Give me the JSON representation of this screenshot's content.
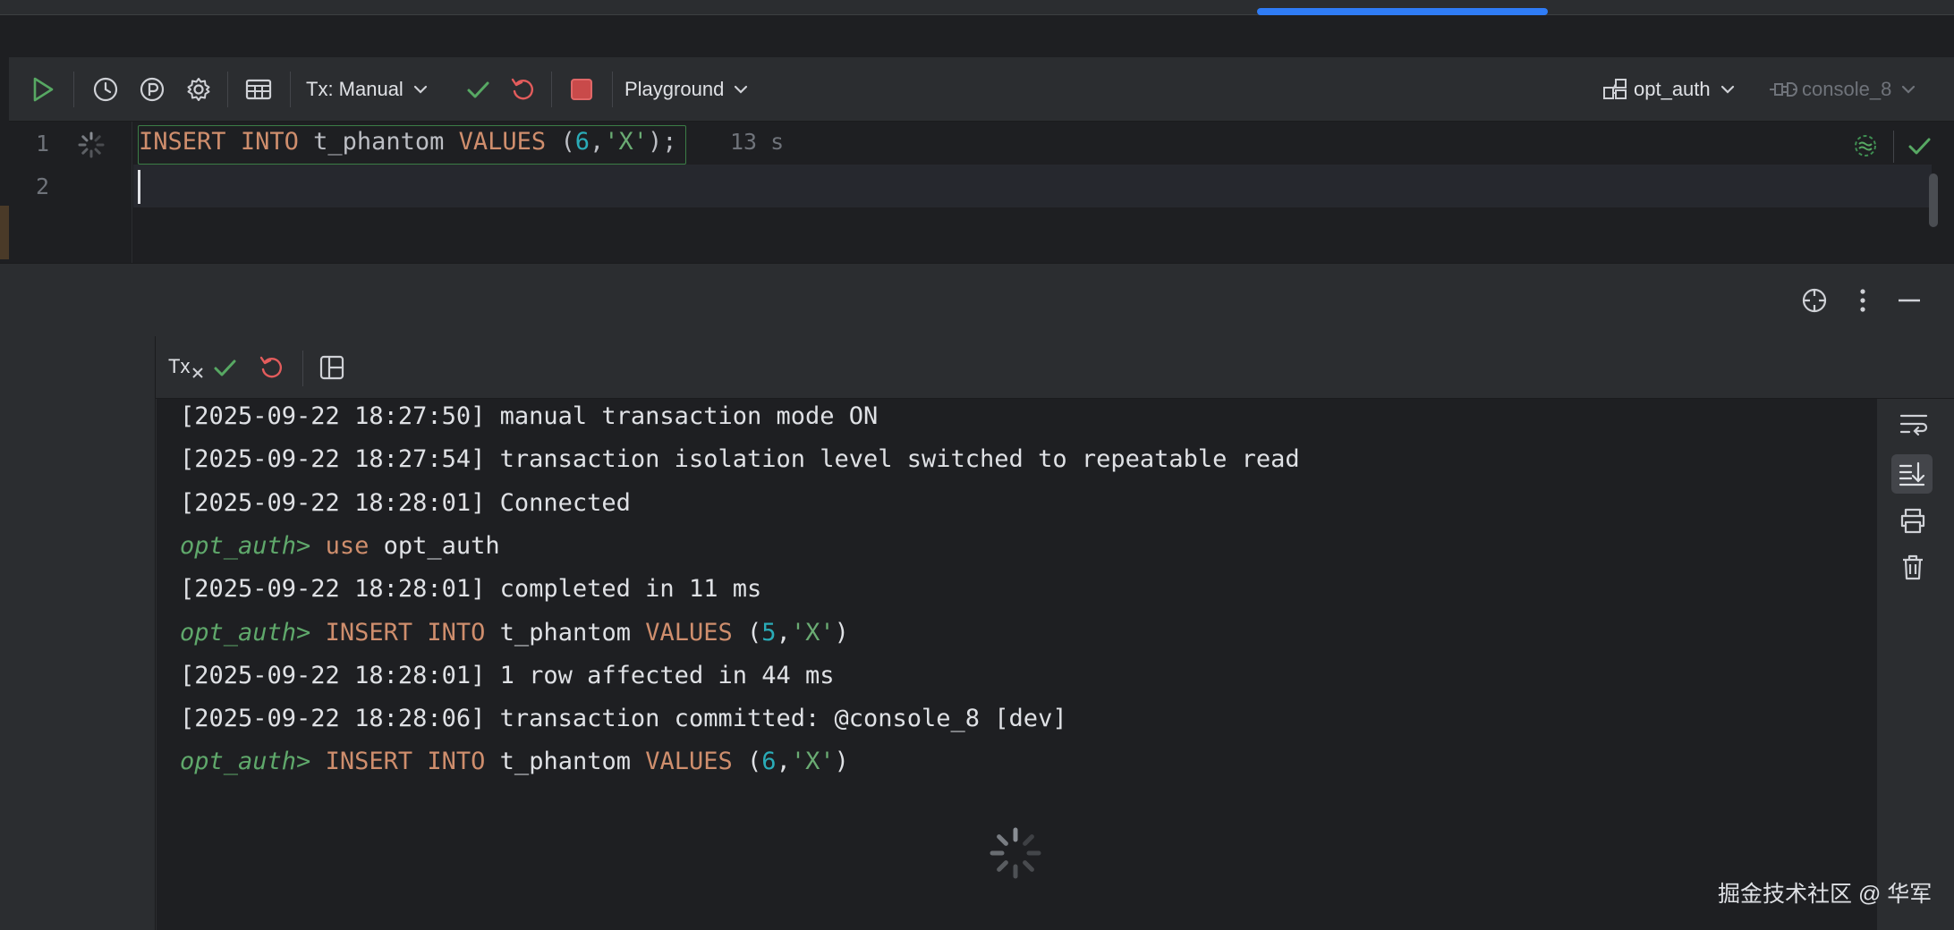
{
  "toolbar": {
    "tx_mode": "Tx: Manual",
    "playground": "Playground",
    "schema": "opt_auth",
    "session": "console_8"
  },
  "editor": {
    "line_numbers": [
      "1",
      "2"
    ],
    "line1_tokens": [
      {
        "t": "INSERT",
        "c": "kw"
      },
      {
        "t": " ",
        "c": ""
      },
      {
        "t": "INTO",
        "c": "kw"
      },
      {
        "t": " t_phantom ",
        "c": ""
      },
      {
        "t": "VALUES",
        "c": "kw"
      },
      {
        "t": " (",
        "c": ""
      },
      {
        "t": "6",
        "c": "num"
      },
      {
        "t": ",",
        "c": ""
      },
      {
        "t": "'X'",
        "c": "str"
      },
      {
        "t": ");",
        "c": ""
      }
    ],
    "elapsed": "13 s"
  },
  "services": {
    "tx_label": "Tx"
  },
  "console": {
    "lines": [
      [
        {
          "t": "[2025-09-22 18:27:50] manual transaction mode ON",
          "c": ""
        }
      ],
      [
        {
          "t": "[2025-09-22 18:27:54] transaction isolation level switched to repeatable read",
          "c": ""
        }
      ],
      [
        {
          "t": "[2025-09-22 18:28:01] Connected",
          "c": ""
        }
      ],
      [
        {
          "t": "opt_auth>",
          "c": "prompt"
        },
        {
          "t": " ",
          "c": ""
        },
        {
          "t": "use",
          "c": "kw"
        },
        {
          "t": " opt_auth",
          "c": ""
        }
      ],
      [
        {
          "t": "[2025-09-22 18:28:01] completed in 11 ms",
          "c": ""
        }
      ],
      [
        {
          "t": "opt_auth>",
          "c": "prompt"
        },
        {
          "t": " ",
          "c": ""
        },
        {
          "t": "INSERT",
          "c": "kw"
        },
        {
          "t": " ",
          "c": ""
        },
        {
          "t": "INTO",
          "c": "kw"
        },
        {
          "t": " t_phantom ",
          "c": ""
        },
        {
          "t": "VALUES",
          "c": "kw"
        },
        {
          "t": " (",
          "c": ""
        },
        {
          "t": "5",
          "c": "num"
        },
        {
          "t": ",",
          "c": ""
        },
        {
          "t": "'X'",
          "c": "str"
        },
        {
          "t": ")",
          "c": ""
        }
      ],
      [
        {
          "t": "[2025-09-22 18:28:01] 1 row affected in 44 ms",
          "c": ""
        }
      ],
      [
        {
          "t": "[2025-09-22 18:28:06] transaction committed: @console_8 [dev]",
          "c": ""
        }
      ],
      [
        {
          "t": "opt_auth>",
          "c": "prompt"
        },
        {
          "t": " ",
          "c": ""
        },
        {
          "t": "INSERT",
          "c": "kw"
        },
        {
          "t": " ",
          "c": ""
        },
        {
          "t": "INTO",
          "c": "kw"
        },
        {
          "t": " t_phantom ",
          "c": ""
        },
        {
          "t": "VALUES",
          "c": "kw"
        },
        {
          "t": " (",
          "c": ""
        },
        {
          "t": "6",
          "c": "num"
        },
        {
          "t": ",",
          "c": ""
        },
        {
          "t": "'X'",
          "c": "str"
        },
        {
          "t": ")",
          "c": ""
        }
      ]
    ]
  },
  "watermark": "掘金技术社区 @ 华军"
}
